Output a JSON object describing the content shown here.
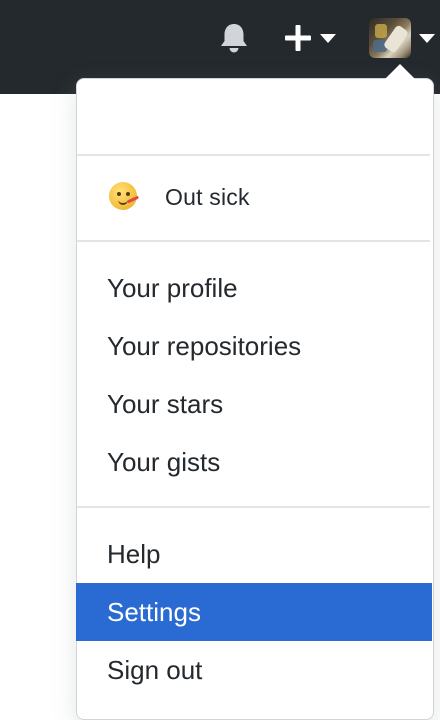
{
  "header": {
    "notifications_icon": "bell-icon",
    "create_icon": "plus-icon",
    "create_caret_icon": "caret-down-icon",
    "avatar_caret_icon": "caret-down-icon"
  },
  "dropdown": {
    "status": {
      "emoji": "face-with-thermometer",
      "text": "Out sick"
    },
    "items": [
      {
        "label": "Your profile"
      },
      {
        "label": "Your repositories"
      },
      {
        "label": "Your stars"
      },
      {
        "label": "Your gists"
      },
      {
        "label": "Help"
      },
      {
        "label": "Settings",
        "active": true
      },
      {
        "label": "Sign out"
      }
    ]
  },
  "colors": {
    "header_bg": "#24292e",
    "active_bg": "#2a6bd3",
    "text": "#24292e"
  }
}
